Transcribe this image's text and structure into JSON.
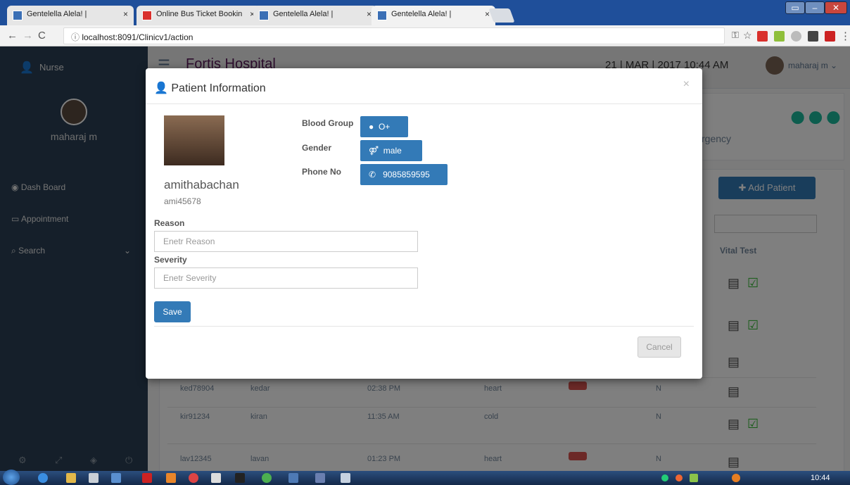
{
  "browser": {
    "tabs": [
      {
        "title": "Gentelella Alela! |",
        "icon": "app-icon"
      },
      {
        "title": "Online Bus Ticket Bookin",
        "icon": "redbus-icon"
      },
      {
        "title": "Gentelella Alela! |",
        "icon": "app-icon"
      },
      {
        "title": "Gentelella Alela! |",
        "icon": "app-icon"
      }
    ],
    "url": "localhost:8091/Clinicv1/action"
  },
  "sidebar": {
    "role": "Nurse",
    "user_name": "maharaj m",
    "items": [
      {
        "label": "Dash Board",
        "icon": "dashboard-icon"
      },
      {
        "label": "Appointment",
        "icon": "laptop-icon"
      },
      {
        "label": "Search",
        "icon": "search-icon"
      }
    ]
  },
  "topnav": {
    "hospital": "Fortis Hospital",
    "datetime": "21 | MAR | 2017 10:44 AM",
    "user": "maharaj m"
  },
  "main": {
    "emergency_label": "rgency",
    "add_patient_label": "Add Patient",
    "vital_header": "Vital Test",
    "rows": [
      {
        "id": "ked78904",
        "name": "kedar",
        "time": "02:38 PM",
        "reason": "heart",
        "flag": "N"
      },
      {
        "id": "kir91234",
        "name": "kiran",
        "time": "11:35 AM",
        "reason": "cold",
        "flag": "N"
      },
      {
        "id": "lav12345",
        "name": "lavan",
        "time": "01:23 PM",
        "reason": "heart",
        "flag": "N"
      }
    ]
  },
  "modal": {
    "title": "Patient Information",
    "patient_name": "amithabachan",
    "patient_id": "ami45678",
    "blood_group_label": "Blood Group",
    "blood_group": "O+",
    "gender_label": "Gender",
    "gender": "male",
    "phone_label": "Phone No",
    "phone": "9085859595",
    "reason_label": "Reason",
    "reason_placeholder": "Enetr Reason",
    "severity_label": "Severity",
    "severity_placeholder": "Enetr Severity",
    "save_label": "Save",
    "cancel_label": "Cancel",
    "close_symbol": "×"
  },
  "taskbar": {
    "clock": "10:44"
  },
  "colors": {
    "primary": "#337ab7",
    "sidebar": "#2a3f54",
    "accent_green": "#1abb9c"
  }
}
